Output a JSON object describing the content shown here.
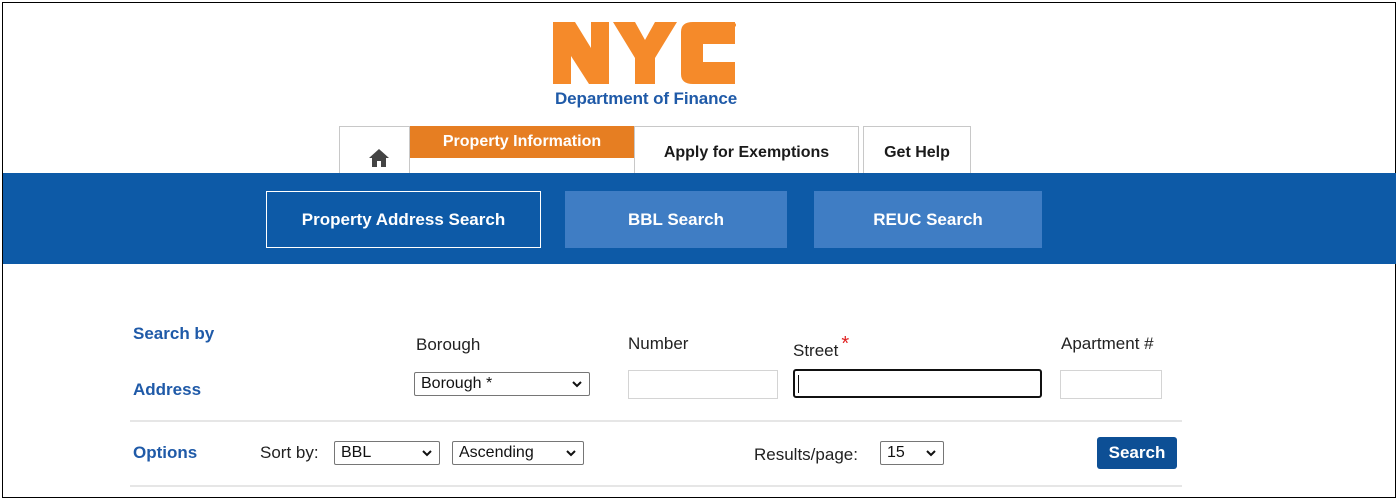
{
  "header": {
    "logo_text": "NYC",
    "department": "Department of Finance",
    "brand_colors": {
      "orange": "#f58a2a",
      "blue": "#1f5aa8"
    }
  },
  "tabs": [
    {
      "label": "",
      "icon": "home-icon"
    },
    {
      "label": "Property Information",
      "active": true
    },
    {
      "label": "Apply for Exemptions"
    },
    {
      "label": "Get Help"
    }
  ],
  "nav": {
    "buttons": [
      {
        "label": "Property Address Search",
        "active": true
      },
      {
        "label": "BBL Search"
      },
      {
        "label": "REUC Search"
      }
    ],
    "band_color": "#0d5aa7"
  },
  "search": {
    "section_label_line1": "Search by",
    "section_label_line2": "Address",
    "borough_label": "Borough",
    "borough_value": "Borough *",
    "number_label": "Number",
    "number_value": "",
    "street_label": "Street",
    "street_required": "*",
    "street_value": "",
    "apartment_label": "Apartment #",
    "apartment_value": ""
  },
  "options": {
    "label": "Options",
    "sort_by_label": "Sort by:",
    "sort_field_value": "BBL",
    "sort_order_value": "Ascending",
    "results_label": "Results/page:",
    "results_value": "15",
    "search_button": "Search"
  }
}
